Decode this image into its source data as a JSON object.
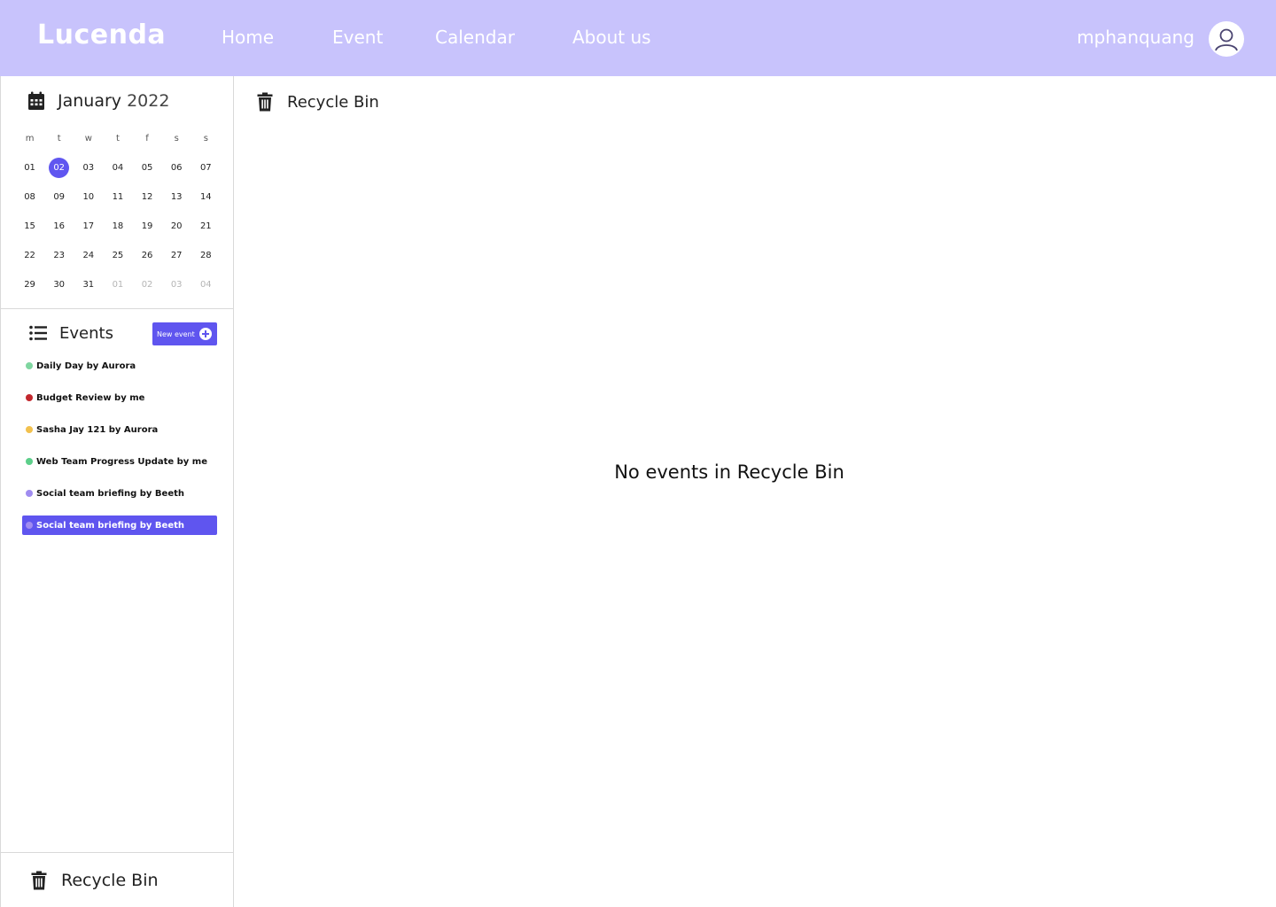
{
  "app": {
    "logo": "Lucenda"
  },
  "nav": {
    "home": "Home",
    "event": "Event",
    "calendar": "Calendar",
    "about": "About us"
  },
  "user": {
    "name": "mphanquang",
    "avatar_icon": "user-icon"
  },
  "calendar": {
    "month": "January",
    "year": "2022",
    "icon": "calendar-icon",
    "weekdays": [
      "m",
      "t",
      "w",
      "t",
      "f",
      "s",
      "s"
    ],
    "weeks": [
      [
        "01",
        "02",
        "03",
        "04",
        "05",
        "06",
        "07"
      ],
      [
        "08",
        "09",
        "10",
        "11",
        "12",
        "13",
        "14"
      ],
      [
        "15",
        "16",
        "17",
        "18",
        "19",
        "20",
        "21"
      ],
      [
        "22",
        "23",
        "24",
        "25",
        "26",
        "27",
        "28"
      ],
      [
        "29",
        "30",
        "31",
        "01",
        "02",
        "03",
        "04"
      ]
    ],
    "selected_day": "02",
    "accent_color": "#6056f0"
  },
  "events": {
    "title": "Events",
    "icon": "list-icon",
    "new_button": "New event",
    "items": [
      {
        "label": "Daily Day by Aurora",
        "color": "#7fd6a0"
      },
      {
        "label": "Budget Review by me",
        "color": "#c2272d"
      },
      {
        "label": "Sasha Jay 121 by Aurora",
        "color": "#f2c14e"
      },
      {
        "label": "Web Team Progress Update by me",
        "color": "#5ccf8a"
      },
      {
        "label": "Social team briefing by Beeth",
        "color": "#a08cf0"
      },
      {
        "label": "Social team briefing by Beeth",
        "color": "#a08cf0"
      }
    ]
  },
  "recycle": {
    "sidebar_label": "Recycle Bin",
    "header_title": "Recycle Bin",
    "empty_message": "No events in Recycle Bin",
    "icon": "trash-icon"
  },
  "colors": {
    "topbar": "#c8c3fc",
    "primary": "#5f55ef"
  }
}
